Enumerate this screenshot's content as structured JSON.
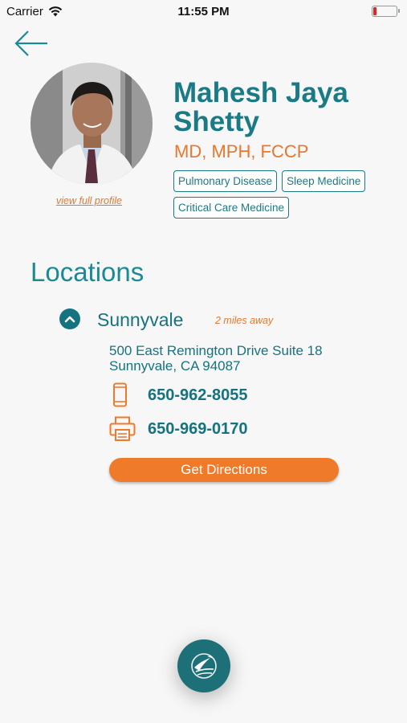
{
  "status_bar": {
    "carrier": "Carrier",
    "time": "11:55 PM"
  },
  "doctor": {
    "name": "Mahesh Jaya Shetty",
    "credentials": "MD, MPH, FCCP",
    "specialties": [
      "Pulmonary Disease",
      "Sleep Medicine",
      "Critical Care Medicine"
    ],
    "profile_link": "view full profile"
  },
  "locations": {
    "title": "Locations",
    "items": [
      {
        "city": "Sunnyvale",
        "distance": "2 miles away",
        "address_line1": "500 East Remington Drive Suite 18",
        "address_line2": "Sunnyvale, CA 94087",
        "phone": "650-962-8055",
        "fax": "650-969-0170",
        "directions_label": "Get Directions"
      }
    ]
  },
  "colors": {
    "teal": "#1a7a85",
    "orange": "#e8772e",
    "button_orange": "#ef7a2a"
  }
}
